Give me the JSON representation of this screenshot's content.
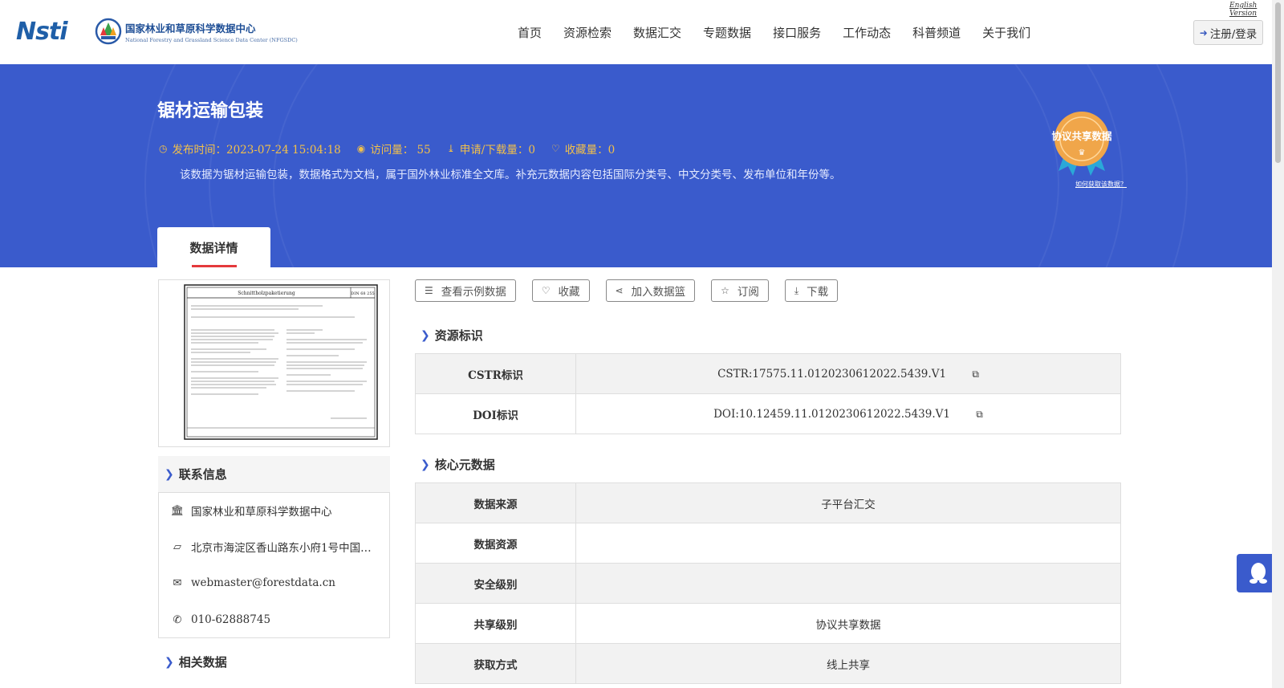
{
  "header": {
    "logo_brand": "Nsti",
    "logo_org_cn": "国家林业和草原科学数据中心",
    "logo_org_en": "National Forestry and Grassland Science Data Center (NFGSDC)",
    "english_link": "English Version",
    "login_label": "注册/登录",
    "nav": [
      "首页",
      "资源检索",
      "数据汇交",
      "专题数据",
      "接口服务",
      "工作动态",
      "科普频道",
      "关于我们"
    ]
  },
  "dataset": {
    "title": "锯材运输包装",
    "publish_time": "发布时间：2023-07-24 15:04:18",
    "visits": "访问量： 55",
    "downloads": "申请/下载量：0",
    "favorites": "收藏量：0",
    "description": "该数据为锯材运输包装，数据格式为文档，属于国外林业标准全文库。补充元数据内容包括国际分类号、中文分类号、发布单位和年份等。",
    "badge_label": "协议共享数据",
    "badge_link": "如何获取该数据？",
    "tab_label": "数据详情"
  },
  "thumbnail": {
    "doc_title": "Schnittholzpaketierung",
    "doc_code": "DIN 68 255"
  },
  "contact": {
    "heading": "联系信息",
    "org": "国家林业和草原科学数据中心",
    "address": "北京市海淀区香山路东小府1号中国…",
    "email": "webmaster@forestdata.cn",
    "phone": "010-62888745"
  },
  "related_heading": "相关数据",
  "actions": {
    "view_sample": "查看示例数据",
    "favorite": "收藏",
    "add_basket": "加入数据篮",
    "subscribe": "订阅",
    "download": "下载"
  },
  "identifiers": {
    "heading": "资源标识",
    "rows": [
      {
        "key": "CSTR标识",
        "value": "CSTR:17575.11.0120230612022.5439.V1"
      },
      {
        "key": "DOI标识",
        "value": "DOI:10.12459.11.0120230612022.5439.V1"
      }
    ]
  },
  "core_metadata": {
    "heading": "核心元数据",
    "rows": [
      {
        "key": "数据来源",
        "value": "子平台汇交"
      },
      {
        "key": "数据资源",
        "value": ""
      },
      {
        "key": "安全级别",
        "value": ""
      },
      {
        "key": "共享级别",
        "value": "协议共享数据"
      },
      {
        "key": "获取方式",
        "value": "线上共享"
      }
    ]
  },
  "colors": {
    "primary_blue": "#3a5bcc",
    "meta_gold": "#f2c04a",
    "accent_red": "#e4393c",
    "badge_orange": "#f0a64a",
    "badge_ribbon": "#2aa8d8"
  }
}
